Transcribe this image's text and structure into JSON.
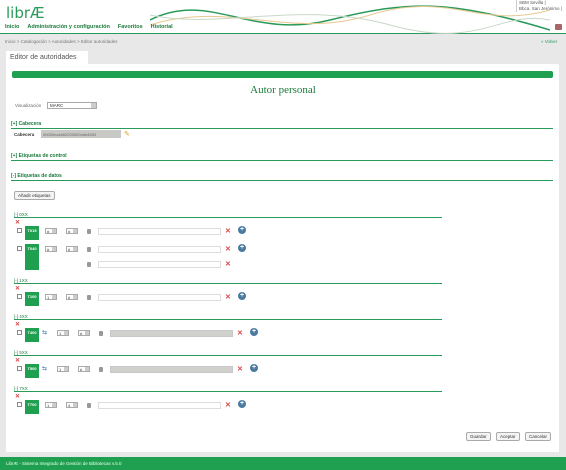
{
  "header": {
    "logo": "librÆ",
    "nav": [
      "Inicio",
      "Administración y configuración",
      "Favoritos",
      "Historial"
    ],
    "user_lines": [
      "SBM Sevilla |",
      "Bbca. San Jerónimo |"
    ]
  },
  "breadcrumb": "Inicio > Catalogación > Autoridades > Editor autoridades",
  "back": "« Volver",
  "tab": "Editor de autoridades",
  "title": "Autor personal",
  "visualization": {
    "label": "Visualización",
    "value": "MARC"
  },
  "sections": {
    "cabecera": "[+] Cabecera",
    "control": "[+] Etiquetas de control",
    "datos": "[-] Etiquetas de datos"
  },
  "cabecera": {
    "label": "Cabecera",
    "value": "00000nz###2200000n##4500"
  },
  "add_tags": "Añadir etiquetas",
  "groups": [
    {
      "title": "[-] 0XX",
      "fields": [
        {
          "tag": "T015",
          "ind1": "#",
          "ind2": "#",
          "sub": 1,
          "link": false,
          "disabled": false
        },
        {
          "tag": "T040",
          "ind1": "#",
          "ind2": "#",
          "sub": 2,
          "link": false,
          "disabled": false
        }
      ]
    },
    {
      "title": "[-] 1XX",
      "fields": [
        {
          "tag": "T100",
          "ind1": "1",
          "ind2": "#",
          "sub": 1,
          "link": false,
          "disabled": false
        }
      ]
    },
    {
      "title": "[-] 4XX",
      "fields": [
        {
          "tag": "T400",
          "ind1": "1",
          "ind2": "#",
          "sub": 1,
          "link": true,
          "disabled": true
        }
      ]
    },
    {
      "title": "[-] 5XX",
      "fields": [
        {
          "tag": "T500",
          "ind1": "1",
          "ind2": "#",
          "sub": 1,
          "link": true,
          "disabled": true
        }
      ]
    },
    {
      "title": "[-] 7XX",
      "fields": [
        {
          "tag": "T700",
          "ind1": "1",
          "ind2": "4",
          "sub": 1,
          "link": false,
          "disabled": false
        }
      ]
    }
  ],
  "buttons": {
    "save": "Guardar",
    "validate": "Aceptar",
    "cancel": "Cancelar"
  },
  "footer": "LibrÆ - Sistema Integrado de Gestión de Bibliotecas v.5.0"
}
